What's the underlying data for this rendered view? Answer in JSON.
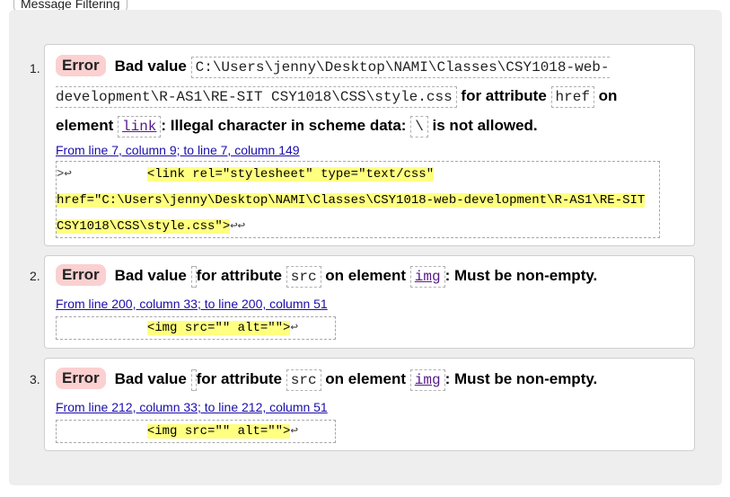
{
  "filter_tab": {
    "label": "Message Filtering"
  },
  "messages": [
    {
      "num": "1.",
      "badge": "Error",
      "bad_value_label": "Bad value",
      "value": "C:\\Users\\jenny\\Desktop\\NAMI\\Classes\\CSY1018-web-development\\R-AS1\\RE-SIT CSY1018\\CSS\\style.css",
      "for_attr_label": "for attribute",
      "attr": "href",
      "on_elem_label": "on element",
      "element": "link",
      "tail_pre": ": Illegal character in scheme data:",
      "char": "\\",
      "tail_post": "is not allowed.",
      "location": "From line 7, column 9; to line 7, column 149",
      "extract": {
        "lead": ">↩          ",
        "hl1": "<link rel=\"stylesheet\" type=\"text/css\"",
        "hl2": "href=\"C:\\Users\\jenny\\Desktop\\NAMI\\Classes\\CSY1018-web-development\\R-AS1\\RE-SIT",
        "hl3": "CSY1018\\CSS\\style.css\">",
        "trail": "↩↩"
      }
    },
    {
      "num": "2.",
      "badge": "Error",
      "bad_value_label": "Bad value",
      "for_attr_label": "for attribute",
      "attr": "src",
      "on_elem_label": "on element",
      "element": "img",
      "tail": ": Must be non-empty.",
      "location": "From line 200, column 33; to line 200, column 51",
      "extract": {
        "lead": "            ",
        "hl": "<img src=\"\" alt=\"\">",
        "trail": "↩"
      }
    },
    {
      "num": "3.",
      "badge": "Error",
      "bad_value_label": "Bad value",
      "for_attr_label": "for attribute",
      "attr": "src",
      "on_elem_label": "on element",
      "element": "img",
      "tail": ": Must be non-empty.",
      "location": "From line 212, column 33; to line 212, column 51",
      "extract": {
        "lead": "            ",
        "hl": "<img src=\"\" alt=\"\">",
        "trail": "↩"
      }
    }
  ]
}
